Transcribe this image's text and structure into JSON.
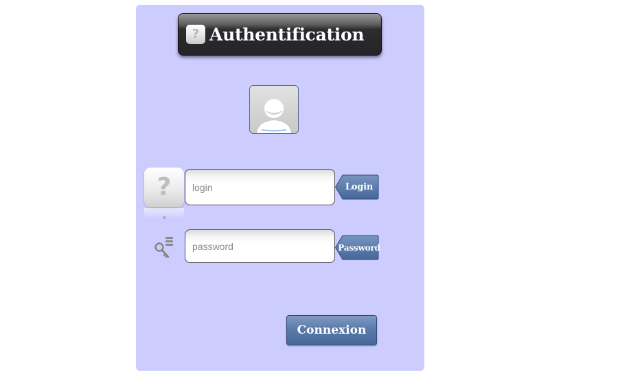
{
  "header": {
    "title": "Authentification",
    "title_icon": "question-icon"
  },
  "avatar": {
    "icon": "user-avatar-icon"
  },
  "form": {
    "login": {
      "icon": "question-icon",
      "placeholder": "login",
      "value": "",
      "label": "Login"
    },
    "password": {
      "icon": "key-icon",
      "placeholder": "password",
      "value": "",
      "label": "Password"
    },
    "submit_label": "Connexion"
  },
  "colors": {
    "panel_background": "#ccccff",
    "title_bar": "#23232a",
    "accent_blue": "#4e6fa1"
  }
}
